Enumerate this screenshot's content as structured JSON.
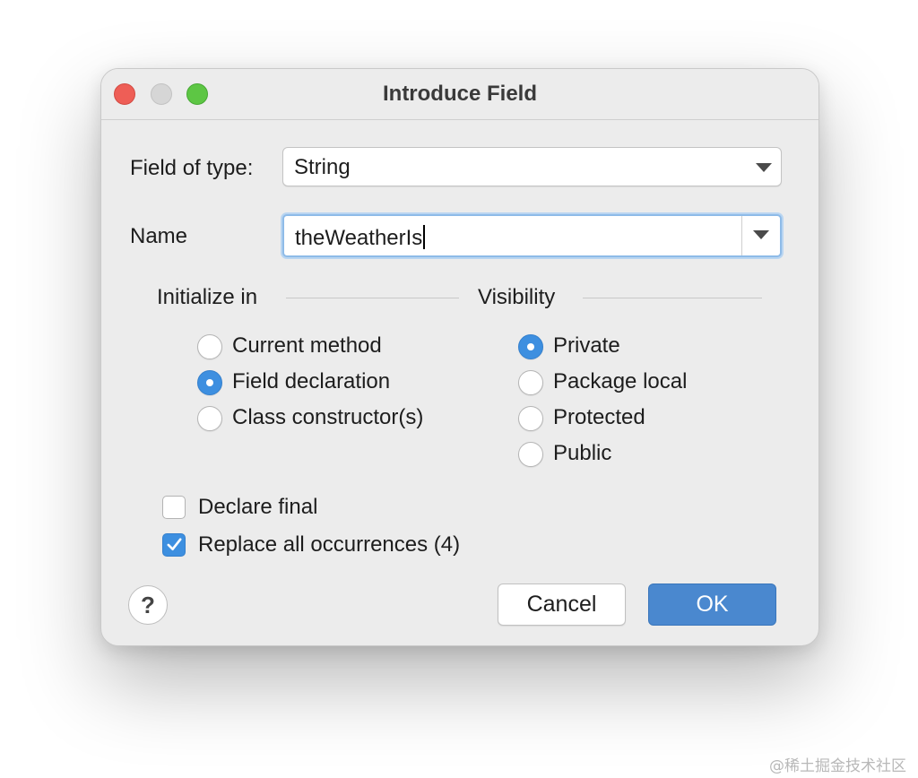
{
  "dialog": {
    "title": "Introduce Field"
  },
  "form": {
    "field_type_label": "Field of type:",
    "field_type_value": "String",
    "name_label": "Name",
    "name_value": "theWeatherIs"
  },
  "initialize": {
    "heading": "Initialize in",
    "options": [
      {
        "label": "Current method",
        "checked": false
      },
      {
        "label": "Field declaration",
        "checked": true
      },
      {
        "label": "Class constructor(s)",
        "checked": false
      }
    ]
  },
  "visibility": {
    "heading": "Visibility",
    "options": [
      {
        "label": "Private",
        "checked": true
      },
      {
        "label": "Package local",
        "checked": false
      },
      {
        "label": "Protected",
        "checked": false
      },
      {
        "label": "Public",
        "checked": false
      }
    ]
  },
  "checkboxes": {
    "declare_final": {
      "label": "Declare final",
      "checked": false
    },
    "replace_all": {
      "label": "Replace all occurrences (4)",
      "checked": true
    }
  },
  "buttons": {
    "help": "?",
    "cancel": "Cancel",
    "ok": "OK"
  },
  "watermark": "@稀土掘金技术社区",
  "colors": {
    "accent": "#3d8fe0",
    "ok_button": "#4a88cf",
    "close": "#ee5e56",
    "minimize": "#d6d6d6",
    "maximize": "#5dc644"
  },
  "icons": {
    "dropdown": "chevron-down-icon",
    "help": "question-mark-icon",
    "check": "checkmark-icon"
  }
}
